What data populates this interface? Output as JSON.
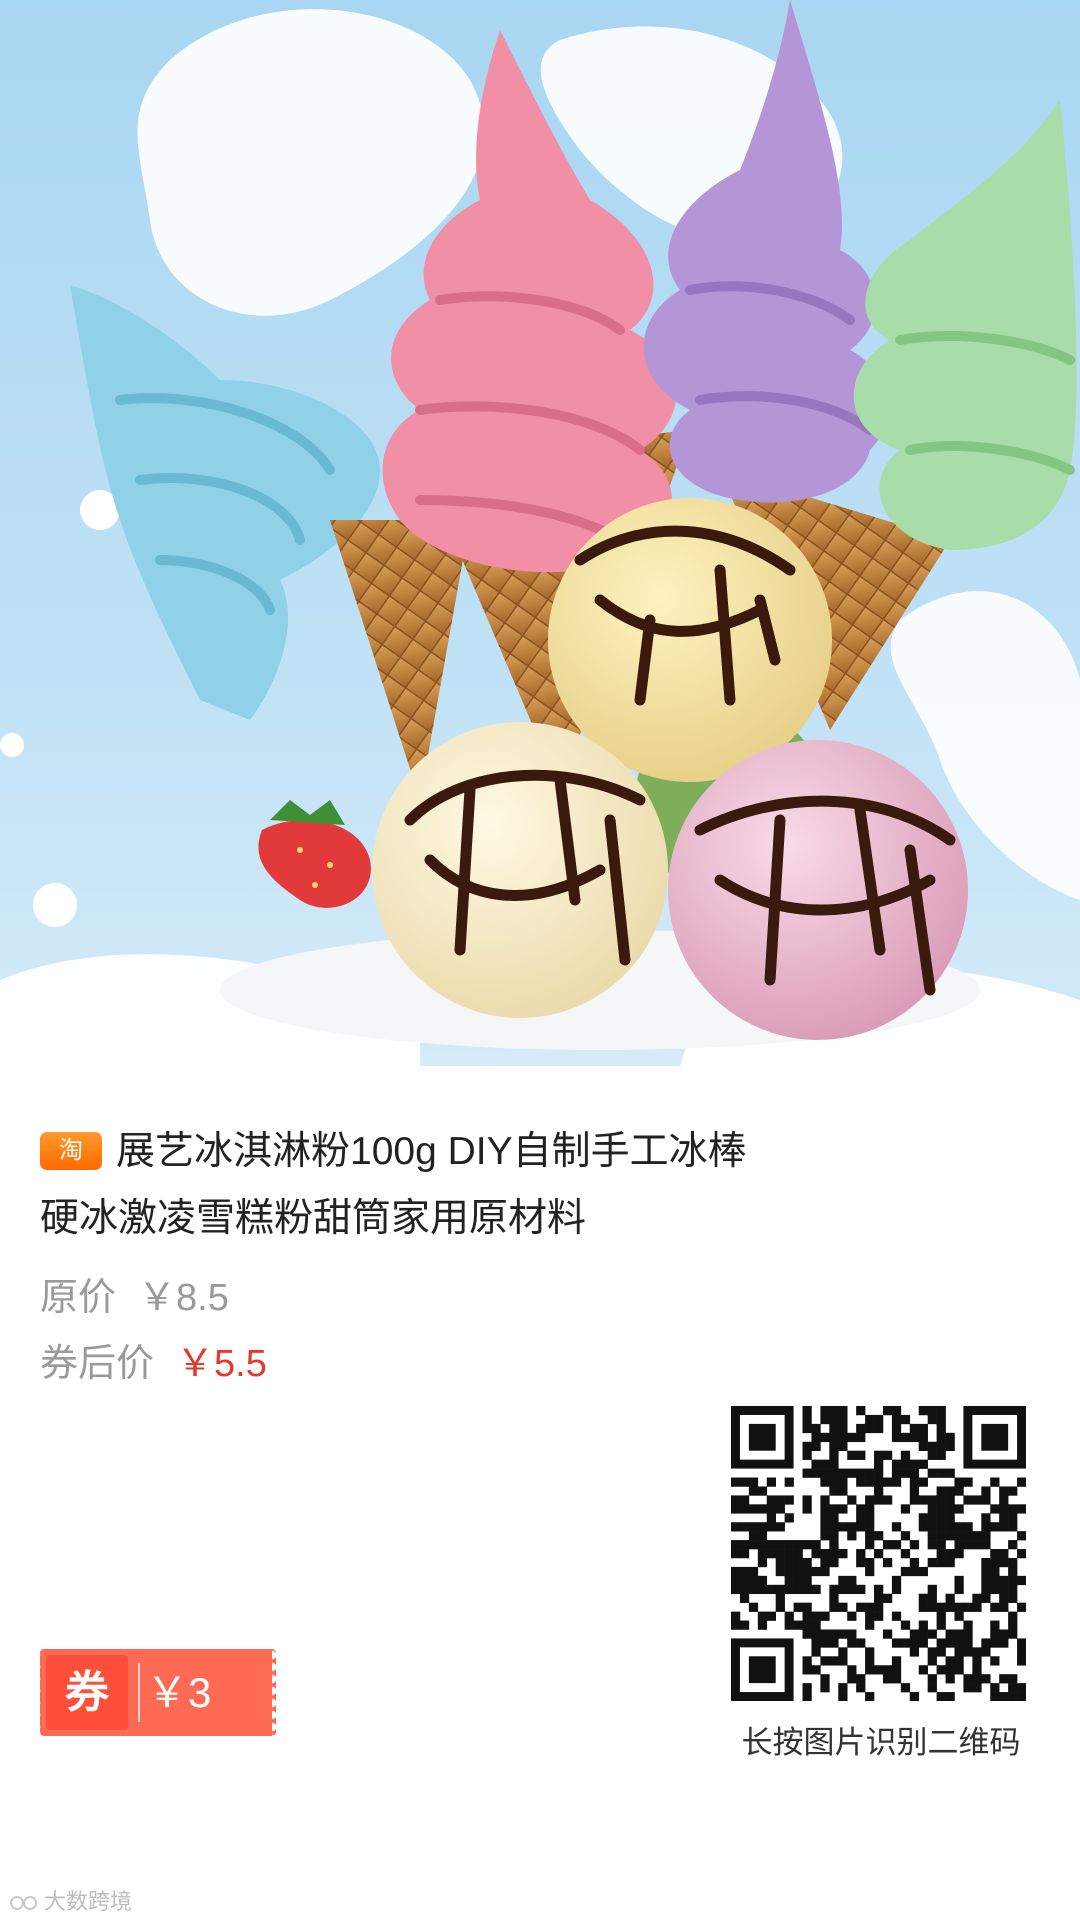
{
  "product": {
    "platform_badge": "淘",
    "title_line1": "展艺冰淇淋粉100g DIY自制手工冰棒",
    "title_line2": "硬冰激凌雪糕粉甜筒家用原材料",
    "image_icon": "ice-cream-product-photo"
  },
  "pricing": {
    "original_label": "原价",
    "original_value": "￥8.5",
    "final_label": "券后价",
    "final_value": "￥5.5"
  },
  "coupon": {
    "tag": "券",
    "amount": "￥3"
  },
  "qr": {
    "icon": "qr-code-icon",
    "caption": "长按图片识别二维码"
  },
  "watermark": {
    "logo_icon": "watermark-logo-icon",
    "text": "大数跨境"
  },
  "colors": {
    "accent_red": "#e33a2c",
    "coupon": "#ff6a55",
    "taobao_orange": "#ff6a00"
  }
}
